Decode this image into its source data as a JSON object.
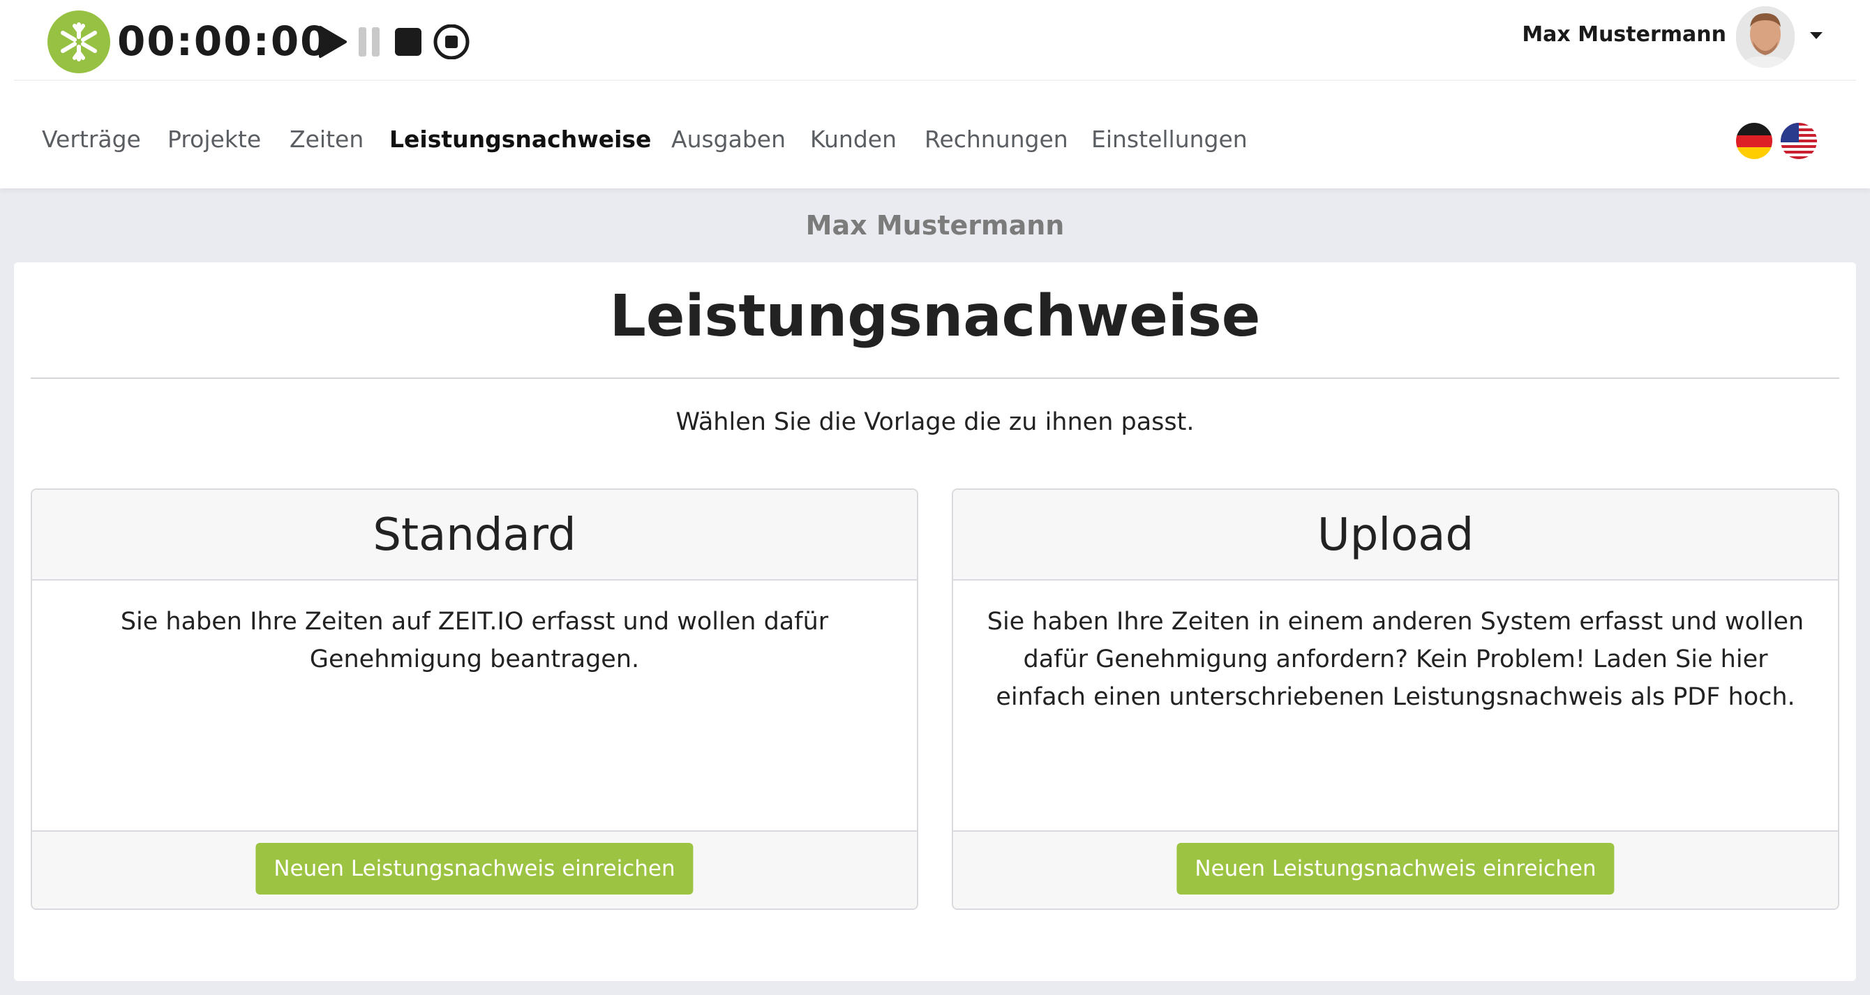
{
  "header": {
    "timer": "00:00:00",
    "user_name": "Max Mustermann",
    "icons": {
      "logo": "zeit-io-logo",
      "play": "play-icon",
      "pause": "pause-icon",
      "stop": "stop-icon",
      "record": "stop-circle-icon",
      "caret": "caret-down-icon"
    },
    "colors": {
      "brand": "#97c142"
    }
  },
  "nav": {
    "items": [
      {
        "label": "Verträge",
        "active": false
      },
      {
        "label": "Projekte",
        "active": false
      },
      {
        "label": "Zeiten",
        "active": false
      },
      {
        "label": "Leistungsnachweise",
        "active": true
      },
      {
        "label": "Ausgaben",
        "active": false
      },
      {
        "label": "Kunden",
        "active": false
      },
      {
        "label": "Rechnungen",
        "active": false
      },
      {
        "label": "Einstellungen",
        "active": false
      }
    ],
    "languages": [
      "flag-de-icon",
      "flag-us-icon"
    ]
  },
  "page": {
    "org_name": "Max Mustermann",
    "title": "Leistungsnachweise",
    "subtitle": "Wählen Sie die Vorlage die zu ihnen passt.",
    "cards": [
      {
        "title": "Standard",
        "body": "Sie haben Ihre Zeiten auf ZEIT.IO erfasst und wollen dafür Genehmigung beantragen.",
        "button": "Neuen Leistungsnachweis einreichen"
      },
      {
        "title": "Upload",
        "body": "Sie haben Ihre Zeiten in einem anderen System erfasst und wollen dafür Genehmigung anfordern? Kein Problem! Laden Sie hier einfach einen unterschriebenen Leistungsnachweis als PDF hoch.",
        "button": "Neuen Leistungsnachweis einreichen"
      }
    ],
    "colors": {
      "button": "#9dc343"
    }
  }
}
